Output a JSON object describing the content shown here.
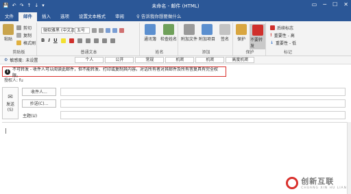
{
  "titlebar": {
    "title": "未命名 - 邮件 (HTML)",
    "quick_access": [
      "💾",
      "↶",
      "↷",
      "↑",
      "↓",
      "▾"
    ],
    "window_buttons": [
      "▭",
      "─",
      "☐",
      "✕"
    ]
  },
  "tabs": [
    {
      "label": "文件"
    },
    {
      "label": "邮件"
    },
    {
      "label": "插入"
    },
    {
      "label": "选项"
    },
    {
      "label": "设置文本格式"
    },
    {
      "label": "审阅"
    }
  ],
  "tell_me": "♀ 告诉我你想要做什么",
  "ribbon": {
    "clipboard": {
      "label": "剪贴板",
      "paste": "粘贴",
      "cut": "剪切",
      "copy": "复制",
      "format_painter": "格式刷"
    },
    "basic_text": {
      "label": "普通文本",
      "font": "微软雅黑 (中文正文)",
      "size": "五号",
      "format_buttons": [
        "B",
        "I",
        "U"
      ]
    },
    "names": {
      "label": "姓名",
      "address_book": "通讯簿",
      "check_names": "检查姓名"
    },
    "add": {
      "label": "添加",
      "attach_file": "附加文件",
      "attach_item": "附加项目",
      "signature": "签名"
    },
    "protect": {
      "label": "保护",
      "protect": "保护",
      "no_forward": "不要转发"
    },
    "tags": {
      "label": "标记",
      "follow_up": "后续标志",
      "high": "重要性 - 高",
      "low": "重要性 - 低"
    }
  },
  "propbar": {
    "sensitivity_label": "敏感度:",
    "sensitivity_value": "未设置",
    "options": [
      "个人",
      "公开",
      "常规",
      "机密",
      "机密",
      "高度机密"
    ]
  },
  "infobar": {
    "icon": "i",
    "text": "不可转发 - 收件人可以阅读此邮件，但不能转发、打印或复制其内容。对话所有者对其邮件及所有答复具有完全权限。"
  },
  "permission_line": "授权人: fu",
  "compose": {
    "send": "发送\n(S)",
    "to_button": "收件人...",
    "cc_button": "抄送(C)...",
    "subject_label": "主题(U)",
    "caret": "|"
  },
  "watermark": {
    "cn": "创新互联",
    "en": "CHUANG XIN HU LIAN"
  },
  "colors": {
    "titlebar": "#2b5797",
    "info_border": "#d9302c"
  }
}
